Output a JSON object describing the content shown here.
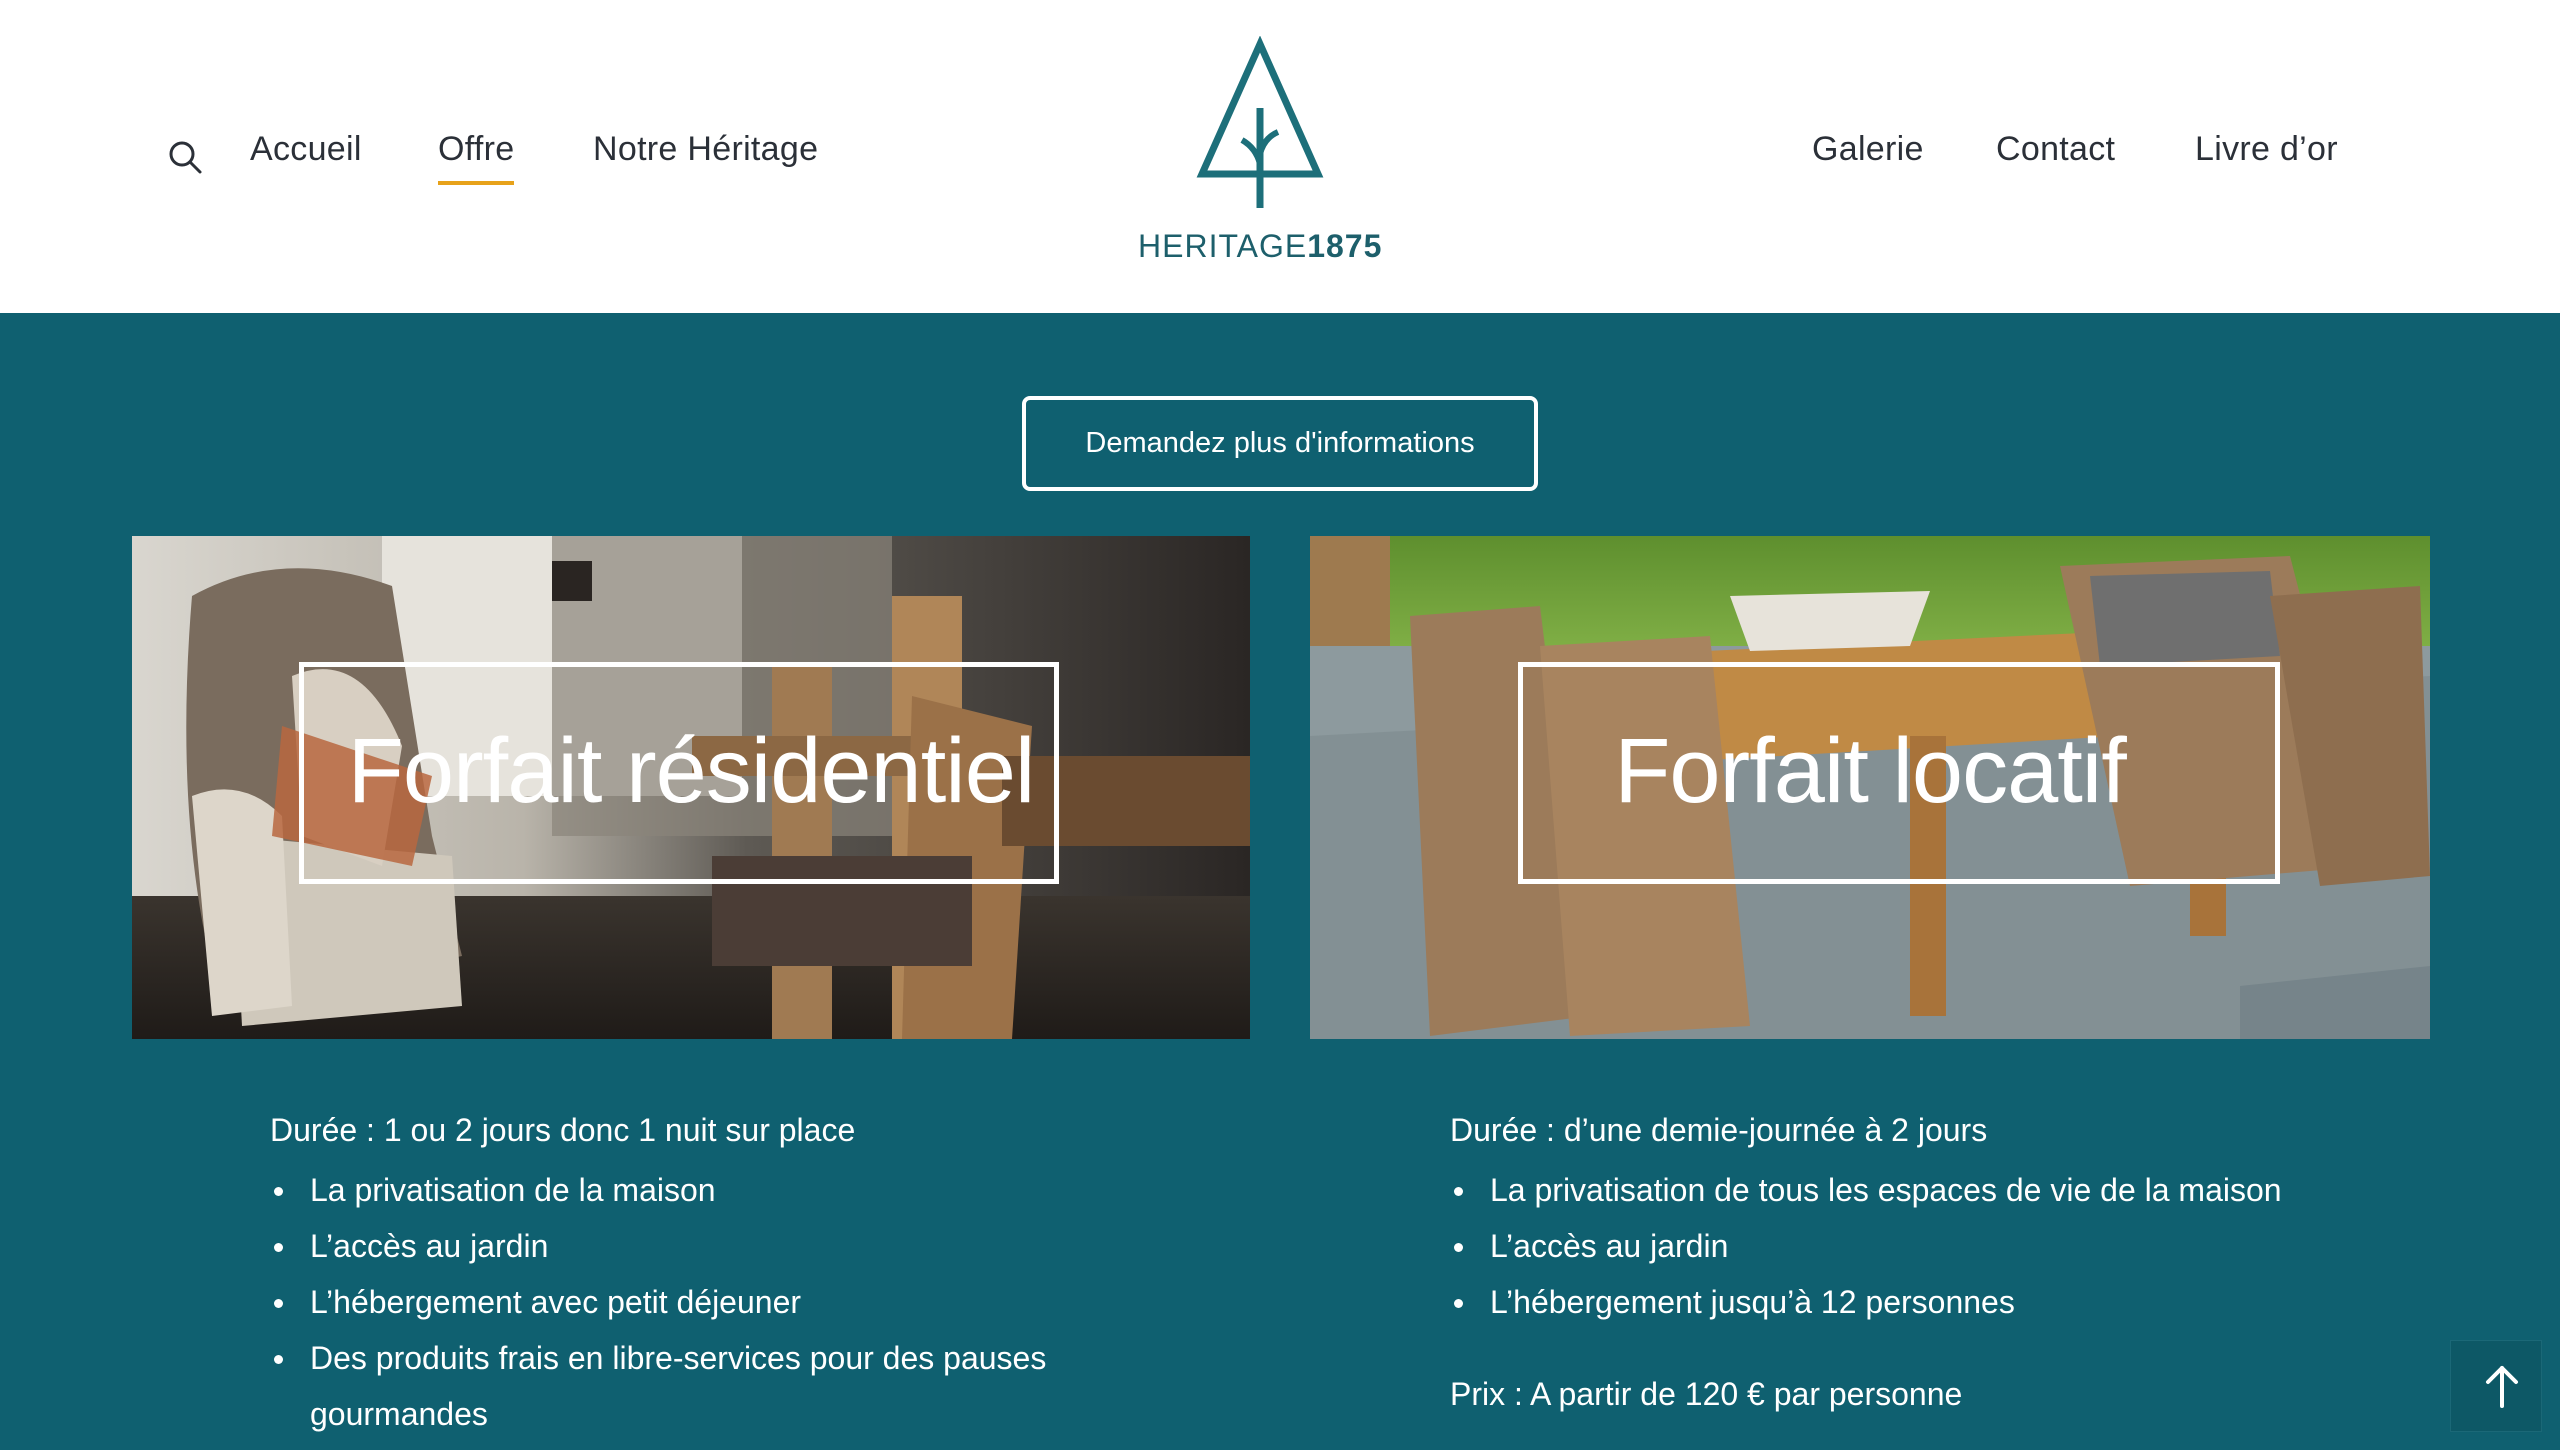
{
  "nav": {
    "left": [
      "Accueil",
      "Offre",
      "Notre Héritage"
    ],
    "right": [
      "Galerie",
      "Contact",
      "Livre d’or"
    ],
    "active": "Offre",
    "active_underline_color": "#e7a21a",
    "search_icon": "search-icon"
  },
  "logo": {
    "word": "HERITAGE",
    "year": "1875",
    "icon": "tree-icon",
    "color": "#1d5f6b"
  },
  "cta": {
    "label": "Demandez plus d'informations"
  },
  "cards": [
    {
      "title": "Forfait résidentiel",
      "image": "armchair-interior-photo",
      "duration": "Durée : 1 ou 2 jours donc 1 nuit sur place",
      "features": [
        "La privatisation de la maison",
        "L’accès au jardin",
        "L’hébergement avec petit déjeuner",
        "Des produits frais en libre-services pour des pauses",
        "gourmandes"
      ]
    },
    {
      "title": "Forfait locatif",
      "image": "garden-dining-table-photo",
      "duration": "Durée : d’une demie-journée à 2 jours",
      "features": [
        "La privatisation de tous les espaces de vie de la maison",
        "L’accès au jardin",
        "L’hébergement jusqu’à 12 personnes"
      ],
      "price": "Prix : A partir de 120 € par personne"
    }
  ],
  "scroll_top_icon": "arrow-up-icon",
  "colors": {
    "background": "#0f6070",
    "header": "#ffffff",
    "accent": "#e7a21a"
  }
}
